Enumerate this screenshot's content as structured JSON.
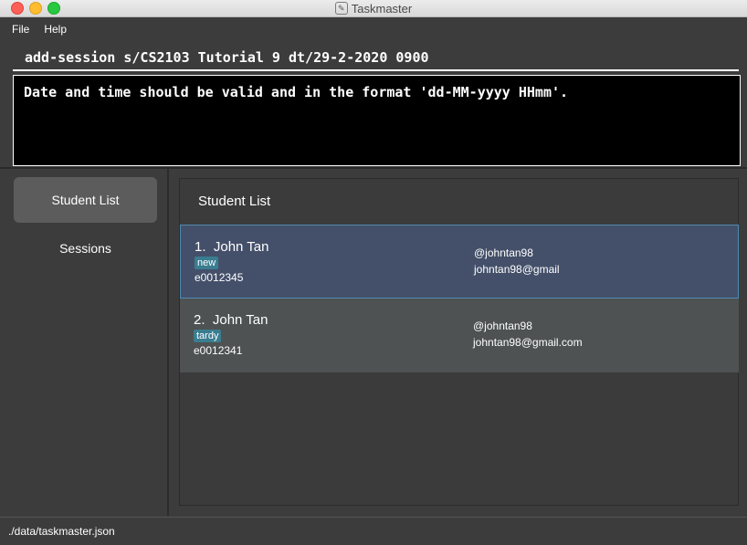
{
  "window": {
    "title": "Taskmaster"
  },
  "menu": [
    "File",
    "Help"
  ],
  "command": {
    "value": "add-session s/CS2103 Tutorial 9 dt/29-2-2020 0900"
  },
  "result": {
    "message": "Date and time should be valid and in the format 'dd-MM-yyyy HHmm'."
  },
  "sidebar": {
    "items": [
      {
        "label": "Student List",
        "active": true
      },
      {
        "label": "Sessions",
        "active": false
      }
    ]
  },
  "panel": {
    "title": "Student List",
    "students": [
      {
        "index": "1.",
        "name": "John Tan",
        "tag": "new",
        "student_id": "e0012345",
        "telegram": "@johntan98",
        "email": "johntan98@gmail"
      },
      {
        "index": "2.",
        "name": "John Tan",
        "tag": "tardy",
        "student_id": "e0012341",
        "telegram": "@johntan98",
        "email": "johntan98@gmail.com"
      }
    ]
  },
  "status": {
    "path": "./data/taskmaster.json"
  },
  "colors": {
    "background": "#3c3c3c",
    "selected_row": "#44506a",
    "tag": "#3a7d91"
  }
}
